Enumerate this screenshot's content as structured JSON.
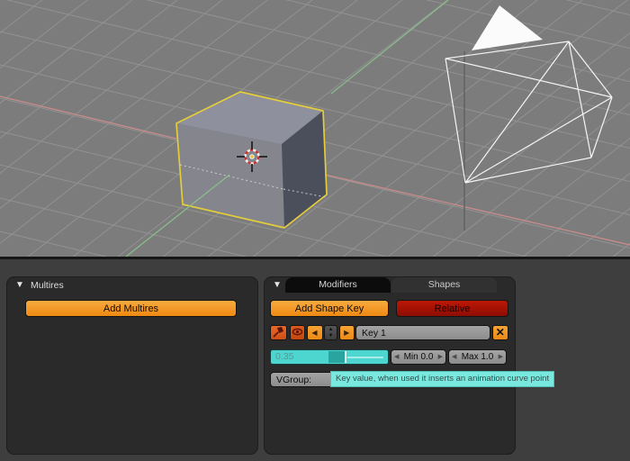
{
  "viewport": {
    "bg_color": "#7c7c7c",
    "grid_color": "#929292",
    "x_axis_color": "#c98c8c",
    "y_axis_color": "#8abc8a",
    "selection_outline_color": "#e3cd3b",
    "objects": [
      "selected-cube",
      "wireframe-icosphere",
      "3d-cursor",
      "solid-white-triangle"
    ]
  },
  "icons": {
    "collapse": "▼",
    "left_arrow": "◀",
    "right_arrow": "▶",
    "spinner_up": "▲",
    "spinner_down": "▼",
    "delete_x": "✕",
    "step_left": "◀",
    "step_right": "▶"
  },
  "multires": {
    "title": "Multires",
    "add_button": "Add Multires"
  },
  "shapes": {
    "tabs": [
      {
        "label": "Modifiers"
      },
      {
        "label": "Shapes"
      }
    ],
    "add_button": "Add Shape Key",
    "relative_button": "Relative",
    "key_name": "Key 1",
    "key_value": "0.35",
    "min_button": "Min 0.0",
    "max_button": "Max 1.0",
    "vgroup_label": "VGroup:"
  },
  "tooltip": {
    "text": "Key value, when used it inserts an animation curve point",
    "bg_color": "#79e9df"
  },
  "colors": {
    "accent_orange": "#f09a28",
    "danger_red": "#a81104",
    "slider_cyan": "#4dd5cf",
    "panel_bg": "#2a2a2a",
    "window_bg": "#3e3e3e"
  }
}
